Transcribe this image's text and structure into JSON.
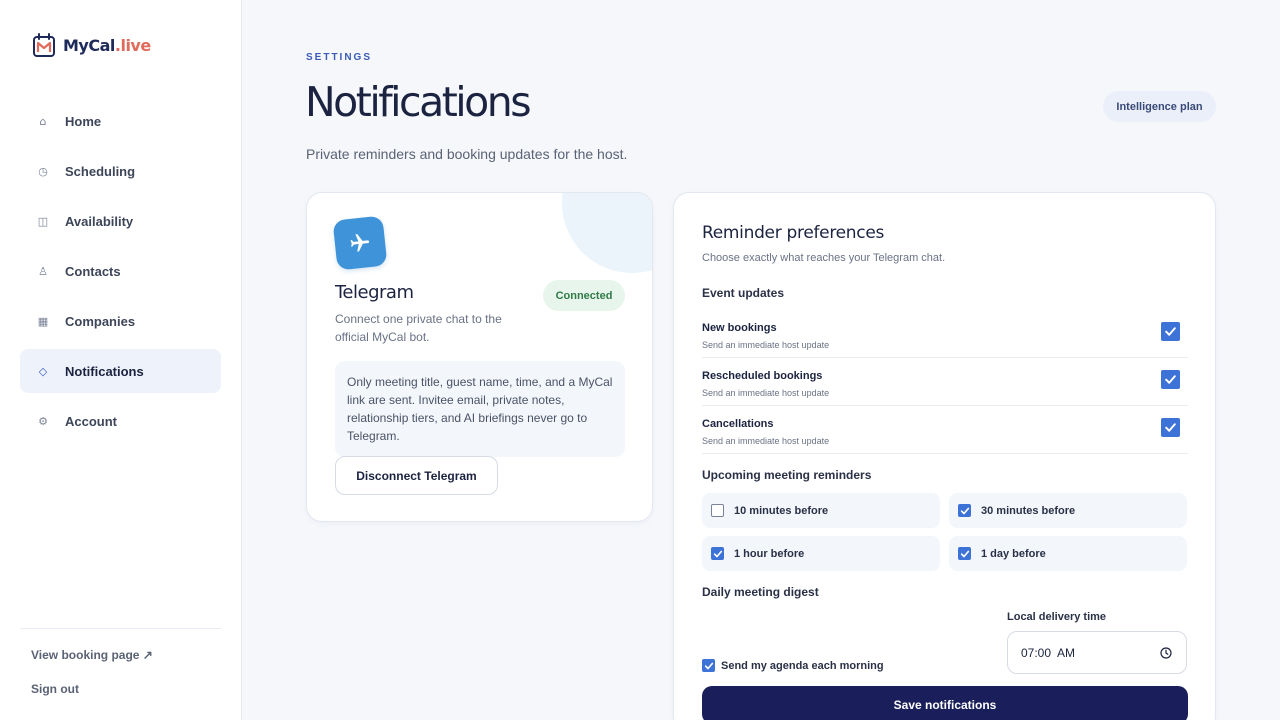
{
  "brand": {
    "name_main": "MyCal",
    "name_accent": ".live"
  },
  "sidebar": {
    "items": [
      {
        "label": "Home",
        "icon": "home-icon",
        "glyph": "⌂"
      },
      {
        "label": "Scheduling",
        "icon": "clock-icon",
        "glyph": "◷"
      },
      {
        "label": "Availability",
        "icon": "calendar-icon",
        "glyph": "◫"
      },
      {
        "label": "Contacts",
        "icon": "person-icon",
        "glyph": "♙"
      },
      {
        "label": "Companies",
        "icon": "building-icon",
        "glyph": "▦"
      },
      {
        "label": "Notifications",
        "icon": "bell-icon",
        "glyph": "◇",
        "active": true
      },
      {
        "label": "Account",
        "icon": "gear-icon",
        "glyph": "⚙"
      }
    ],
    "view_booking": "View booking page ↗",
    "sign_out": "Sign out"
  },
  "header": {
    "eyebrow": "SETTINGS",
    "title": "Notifications",
    "subtitle": "Private reminders and booking updates for the host.",
    "plan_badge": "Intelligence plan"
  },
  "telegram": {
    "title": "Telegram",
    "status": "Connected",
    "description": "Connect one private chat to the official MyCal bot.",
    "note": "Only meeting title, guest name, time, and a MyCal link are sent. Invitee email, private notes, relationship tiers, and AI briefings never go to Telegram.",
    "disconnect_label": "Disconnect Telegram",
    "accent_color": "#3f93d8"
  },
  "preferences": {
    "title": "Reminder preferences",
    "subtitle": "Choose exactly what reaches your Telegram chat.",
    "event_updates_heading": "Event updates",
    "event_updates": [
      {
        "name": "New bookings",
        "hint": "Send an immediate host update",
        "checked": true
      },
      {
        "name": "Rescheduled bookings",
        "hint": "Send an immediate host update",
        "checked": true
      },
      {
        "name": "Cancellations",
        "hint": "Send an immediate host update",
        "checked": true
      }
    ],
    "reminders_heading": "Upcoming meeting reminders",
    "reminders": [
      {
        "label": "10 minutes before",
        "checked": false
      },
      {
        "label": "30 minutes before",
        "checked": true
      },
      {
        "label": "1 hour before",
        "checked": true
      },
      {
        "label": "1 day before",
        "checked": true
      }
    ],
    "digest_heading": "Daily meeting digest",
    "digest_label": "Send my agenda each morning",
    "digest_checked": true,
    "time_label": "Local delivery time",
    "time_value": "07:00  AM",
    "save_label": "Save notifications"
  },
  "colors": {
    "primary": "#1a1f5c",
    "checkbox": "#3d72d6",
    "connected": "#2f7a46"
  }
}
